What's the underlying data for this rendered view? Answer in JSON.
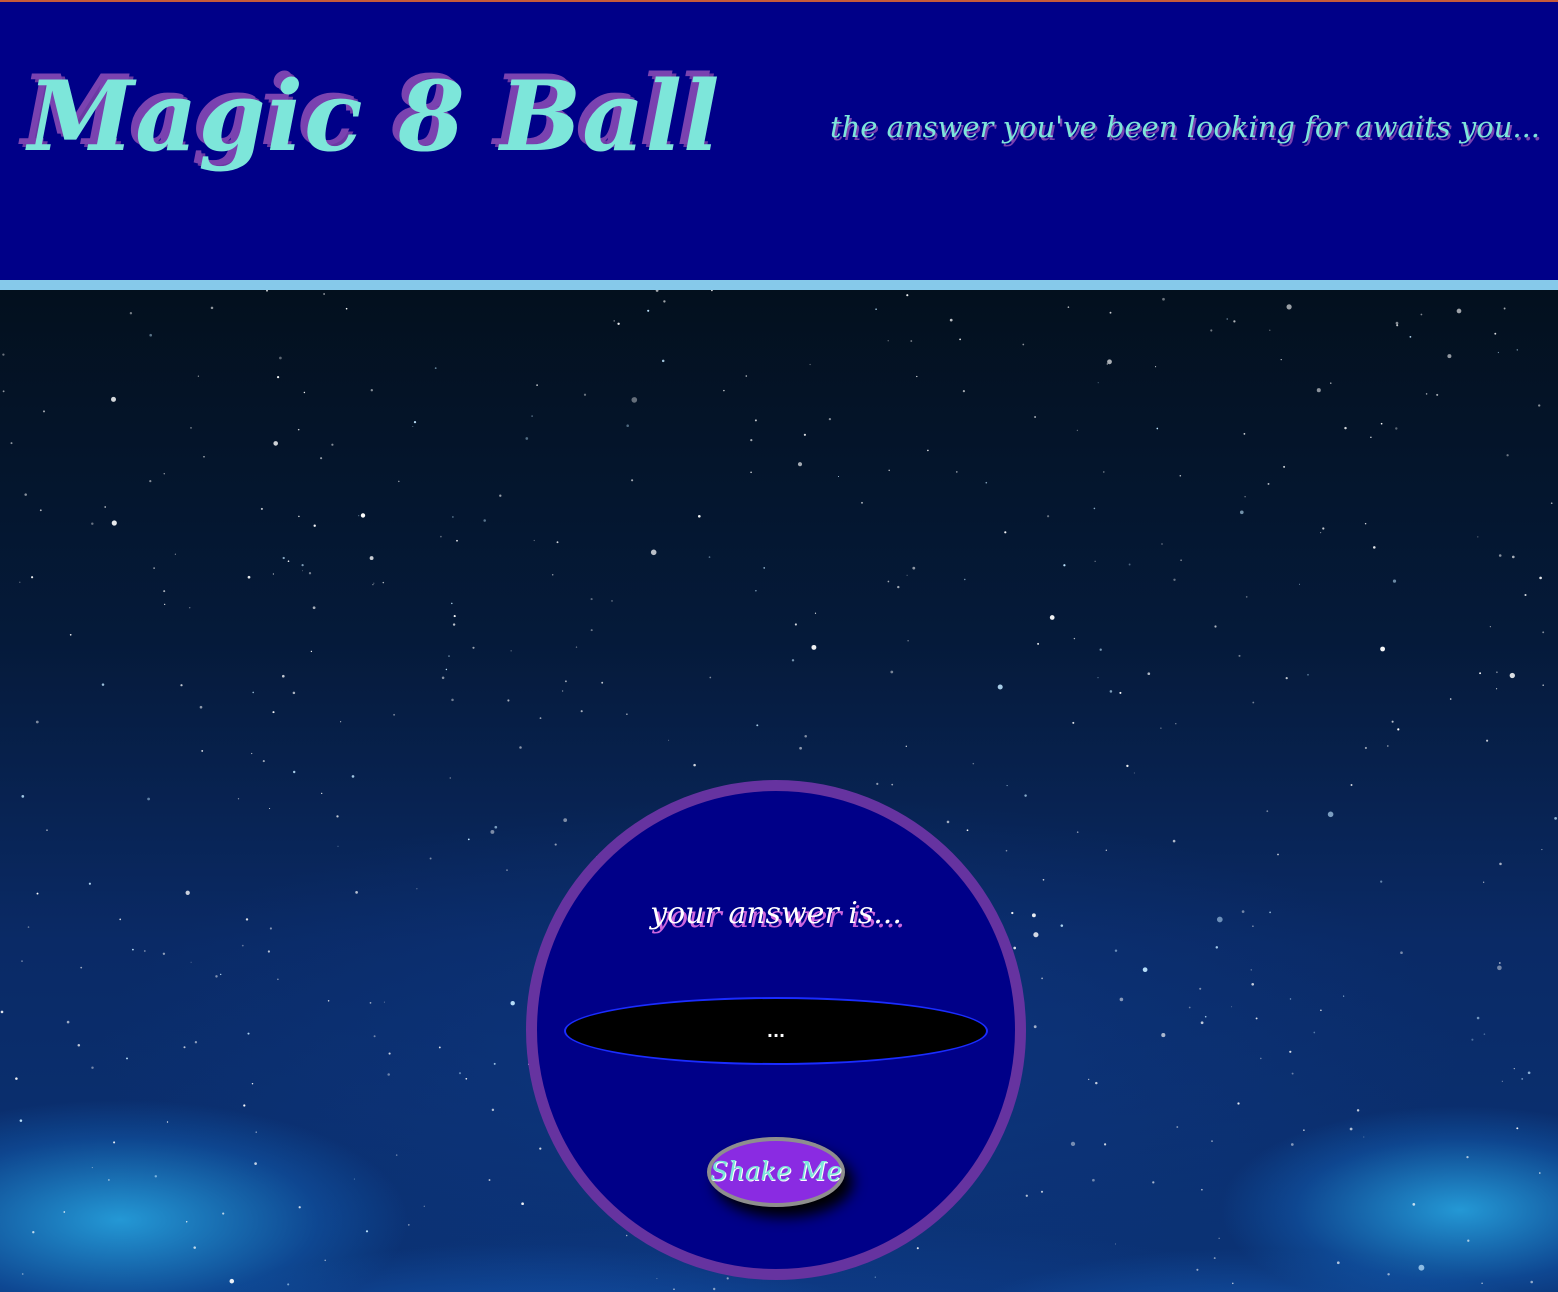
{
  "header": {
    "title": "Magic 8 Ball",
    "tagline": "the answer you've been looking for awaits you..."
  },
  "ball": {
    "answer_label": "your answer is...",
    "answer_text": "...",
    "shake_button_label": "Shake Me"
  },
  "colors": {
    "header_bg": "#000088",
    "header_rule": "#86c9ea",
    "title_fill": "#7de6da",
    "title_shadow": "#7a42b0",
    "ball_fill": "#000088",
    "ball_border": "#6633a0",
    "answer_window": "#000000",
    "button_fill": "#8a2be2"
  }
}
